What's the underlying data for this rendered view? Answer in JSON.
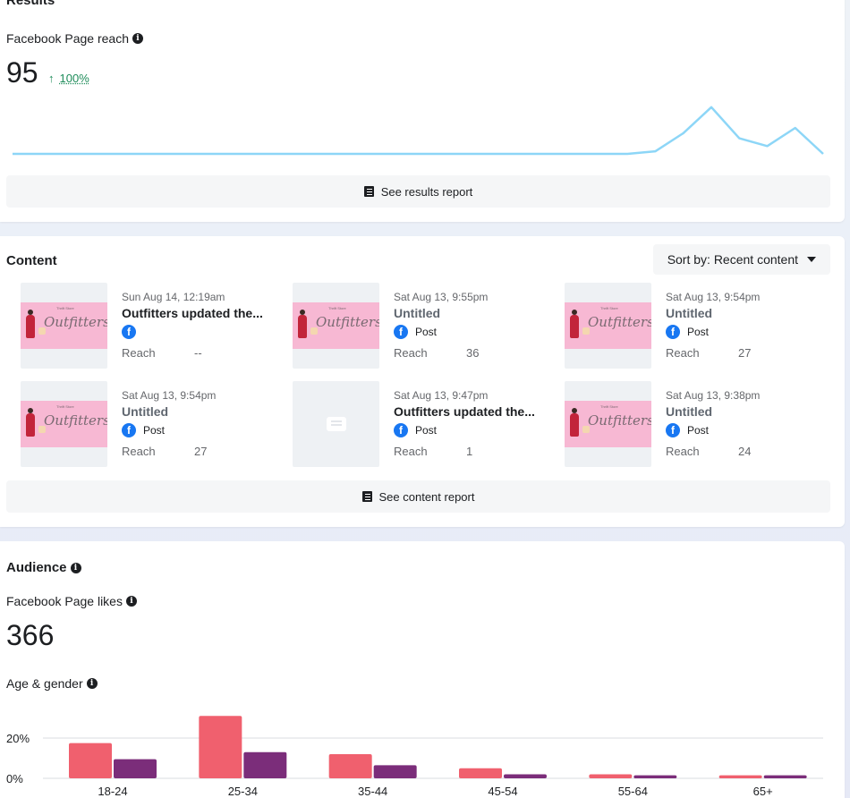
{
  "results": {
    "title": "Results",
    "metric_label": "Facebook Page reach",
    "value": "95",
    "delta_arrow": "↑",
    "delta_pct": "100%",
    "report_button": "See results report",
    "colors": {
      "line": "#8dd6f7",
      "positive": "#1e8c5a"
    }
  },
  "content": {
    "title": "Content",
    "sort_label": "Sort by: Recent content",
    "report_button": "See content report",
    "posts": [
      {
        "date": "Sun Aug 14, 12:19am",
        "title": "Outfitters updated the...",
        "type": "",
        "reach_label": "Reach",
        "reach": "--",
        "thumb": "banner",
        "untitled": false
      },
      {
        "date": "Sat Aug 13, 9:55pm",
        "title": "Untitled",
        "type": "Post",
        "reach_label": "Reach",
        "reach": "36",
        "thumb": "banner",
        "untitled": true
      },
      {
        "date": "Sat Aug 13, 9:54pm",
        "title": "Untitled",
        "type": "Post",
        "reach_label": "Reach",
        "reach": "27",
        "thumb": "banner",
        "untitled": true
      },
      {
        "date": "Sat Aug 13, 9:54pm",
        "title": "Untitled",
        "type": "Post",
        "reach_label": "Reach",
        "reach": "27",
        "thumb": "banner",
        "untitled": true
      },
      {
        "date": "Sat Aug 13, 9:47pm",
        "title": "Outfitters updated the...",
        "type": "Post",
        "reach_label": "Reach",
        "reach": "1",
        "thumb": "placeholder",
        "untitled": false
      },
      {
        "date": "Sat Aug 13, 9:38pm",
        "title": "Untitled",
        "type": "Post",
        "reach_label": "Reach",
        "reach": "24",
        "thumb": "banner",
        "untitled": true
      }
    ],
    "thumb_text": {
      "small": "Thrift Store",
      "script": "Outfitters"
    }
  },
  "audience": {
    "title": "Audience",
    "metric_label": "Facebook Page likes",
    "value": "366",
    "breakdown_label": "Age & gender",
    "colors": {
      "women": "#f0606e",
      "men": "#7b2d7a"
    }
  },
  "chart_data": [
    {
      "type": "line",
      "title": "",
      "x": [
        1,
        2,
        3,
        4,
        5,
        6,
        7,
        8,
        9,
        10,
        11,
        12,
        13,
        14,
        15,
        16,
        17,
        18,
        19,
        20,
        21,
        22,
        23,
        24,
        25,
        26,
        27,
        28
      ],
      "series": [
        {
          "values": [
            0,
            0,
            0,
            0,
            0,
            0,
            0,
            0,
            0,
            0,
            0,
            0,
            0,
            0,
            0,
            0,
            0,
            0,
            0,
            0,
            0,
            0,
            0,
            1,
            8,
            18,
            6,
            3,
            10,
            0
          ]
        }
      ],
      "ylim": [
        0,
        20
      ],
      "grid": false
    },
    {
      "type": "bar",
      "title": "",
      "categories": [
        "18-24",
        "25-34",
        "35-44",
        "45-54",
        "55-64",
        "65+"
      ],
      "series": [
        {
          "values": [
            17.5,
            31,
            12,
            5,
            2,
            1.5
          ]
        },
        {
          "values": [
            9.5,
            13,
            6.5,
            2,
            1.5,
            1.5
          ]
        }
      ],
      "y_ticks": [
        "0%",
        "20%"
      ],
      "ylim": [
        0,
        35
      ],
      "grid": true
    }
  ]
}
